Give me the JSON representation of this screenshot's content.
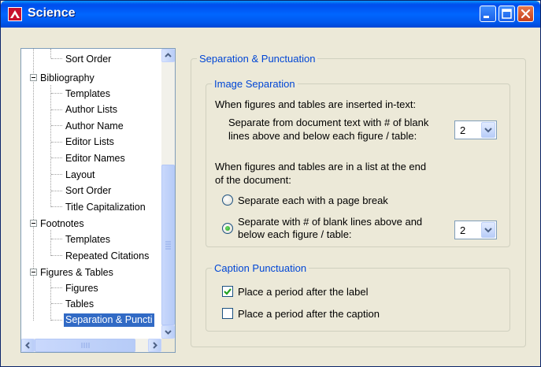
{
  "window": {
    "title": "Science",
    "controls": [
      "minimize",
      "maximize",
      "close"
    ]
  },
  "tree": {
    "items": [
      {
        "label": "Sort Order",
        "level": 2
      },
      {
        "label": "Bibliography",
        "level": 1,
        "expanded": true
      },
      {
        "label": "Templates",
        "level": 2
      },
      {
        "label": "Author Lists",
        "level": 2
      },
      {
        "label": "Author Name",
        "level": 2
      },
      {
        "label": "Editor Lists",
        "level": 2
      },
      {
        "label": "Editor Names",
        "level": 2
      },
      {
        "label": "Layout",
        "level": 2
      },
      {
        "label": "Sort Order",
        "level": 2
      },
      {
        "label": "Title Capitalization",
        "level": 2
      },
      {
        "label": "Footnotes",
        "level": 1,
        "expanded": true
      },
      {
        "label": "Templates",
        "level": 2
      },
      {
        "label": "Repeated Citations",
        "level": 2
      },
      {
        "label": "Figures & Tables",
        "level": 1,
        "expanded": true
      },
      {
        "label": "Figures",
        "level": 2
      },
      {
        "label": "Tables",
        "level": 2
      },
      {
        "label": "Separation & Puncti",
        "level": 2,
        "selected": true
      }
    ]
  },
  "panel": {
    "title": "Separation & Punctuation",
    "image_separation": {
      "title": "Image Separation",
      "intext_heading": "When figures and tables are inserted in-text:",
      "intext_label_line1": "Separate from document text with # of blank",
      "intext_label_line2": "lines above and below each figure / table:",
      "intext_value": "2",
      "list_heading_line1": "When figures and tables are in a list at the end",
      "list_heading_line2": "of the document:",
      "radio_page_break": "Separate each with a page break",
      "radio_blank_line1": "Separate with # of blank lines above and",
      "radio_blank_line2": "below each figure / table:",
      "list_value": "2",
      "selected_option": "blank_lines"
    },
    "caption_punctuation": {
      "title": "Caption Punctuation",
      "after_label": "Place a period after the label",
      "after_label_checked": true,
      "after_caption": "Place a period after the caption",
      "after_caption_checked": false
    }
  },
  "colors": {
    "group_title": "#0046d5",
    "selection": "#316ac5",
    "titlebar": "#0058ee"
  }
}
